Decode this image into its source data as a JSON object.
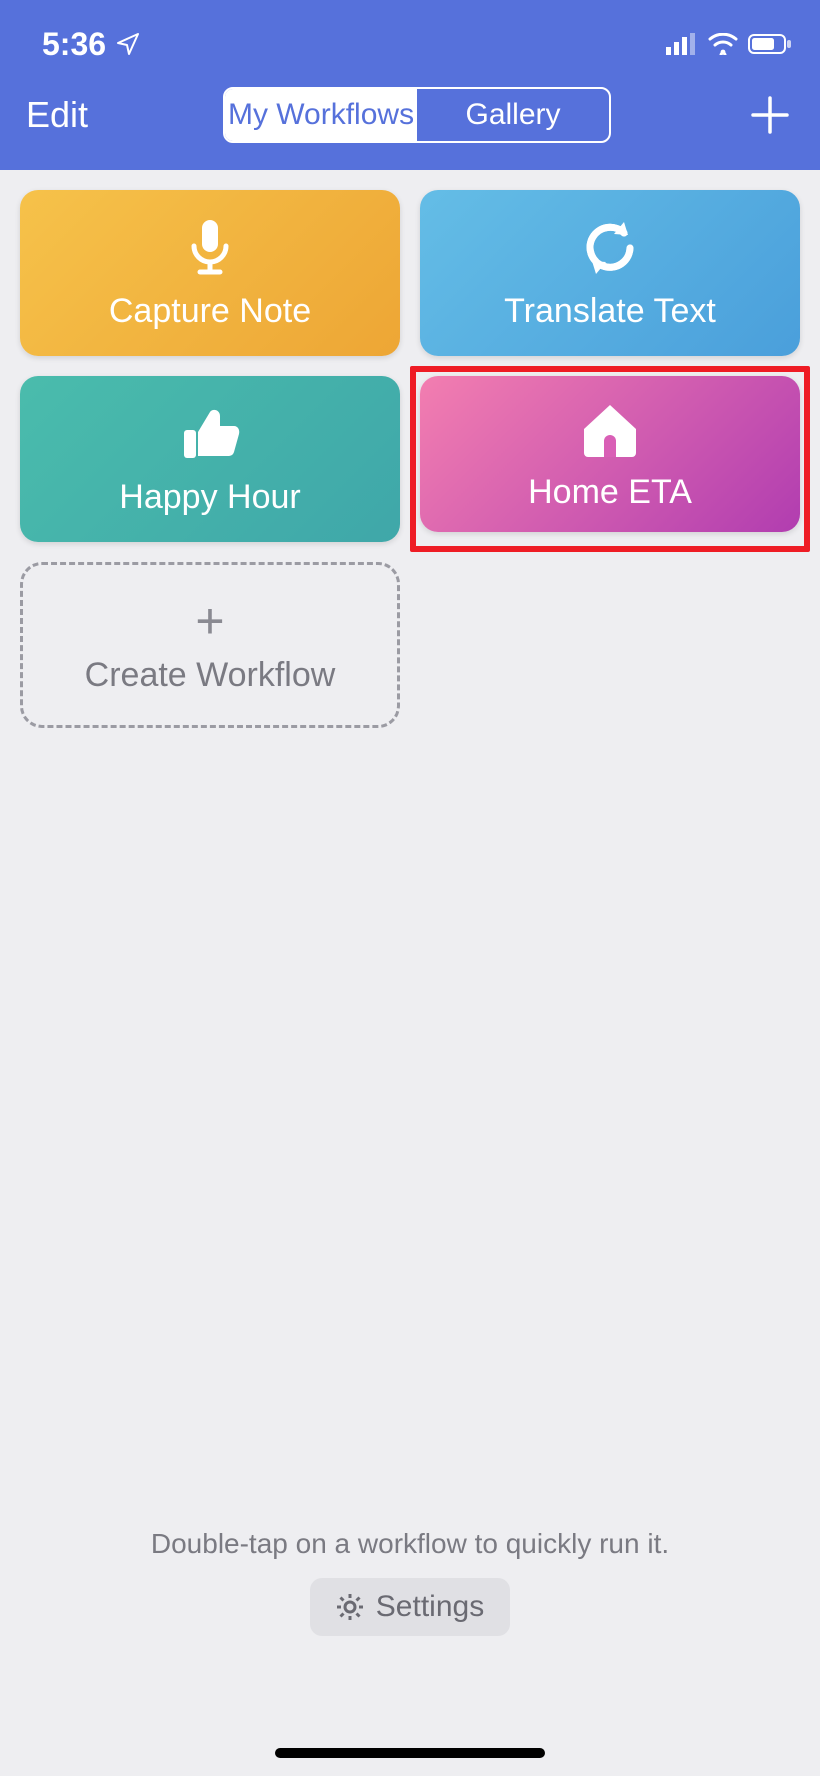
{
  "status": {
    "time": "5:36"
  },
  "nav": {
    "edit": "Edit",
    "tabs": {
      "my": "My Workflows",
      "gallery": "Gallery"
    }
  },
  "tiles": {
    "capture": "Capture Note",
    "translate": "Translate Text",
    "happy": "Happy Hour",
    "home": "Home ETA",
    "create": "Create Workflow"
  },
  "footer": {
    "hint": "Double-tap on a workflow to quickly run it.",
    "settings": "Settings"
  }
}
